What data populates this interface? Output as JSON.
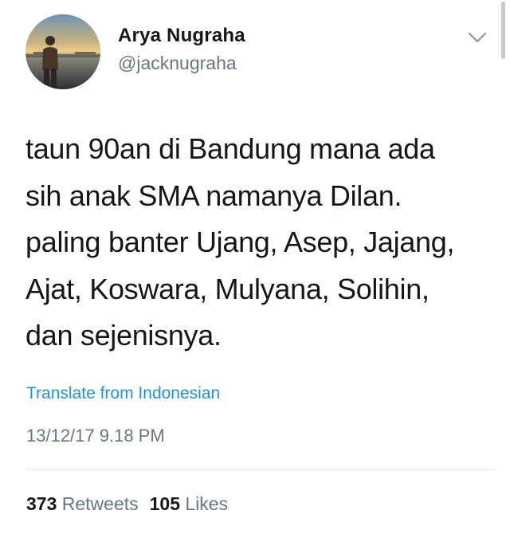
{
  "author": {
    "name": "Arya Nugraha",
    "handle": "@jacknugraha"
  },
  "tweet": {
    "lines": [
      "taun 90an di Bandung mana ada",
      "sih anak SMA namanya Dilan.",
      "paling banter Ujang, Asep, Jajang,",
      "Ajat, Koswara, Mulyana, Solihin,",
      "dan sejenisnya."
    ],
    "translate_label": "Translate from Indonesian",
    "timestamp": "13/12/17 9.18 PM"
  },
  "stats": {
    "retweets_count": "373",
    "retweets_label": "Retweets",
    "likes_count": "105",
    "likes_label": "Likes"
  },
  "icons": {
    "menu": "chevron-down-icon"
  },
  "colors": {
    "link": "#1b95e0",
    "secondary_text": "#657786",
    "primary_text": "#14171a",
    "divider": "#e1e8ed"
  }
}
